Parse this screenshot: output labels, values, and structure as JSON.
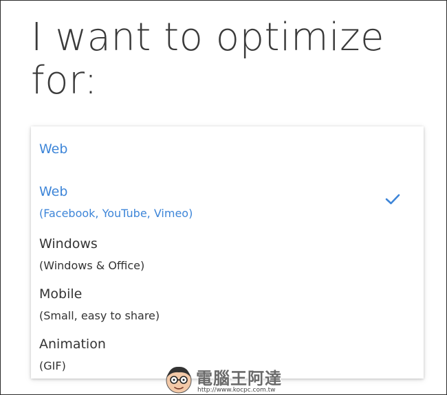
{
  "heading": "I want to optimize for:",
  "dropdown": {
    "selected_value": "Web",
    "options": [
      {
        "title": "Web",
        "subtitle": "(Facebook, YouTube, Vimeo)",
        "selected": true
      },
      {
        "title": "Windows",
        "subtitle": "(Windows & Office)",
        "selected": false
      },
      {
        "title": "Mobile",
        "subtitle": "(Small, easy to share)",
        "selected": false
      },
      {
        "title": "Animation",
        "subtitle": "(GIF)",
        "selected": false
      }
    ]
  },
  "watermark": {
    "brand": "電腦王阿達",
    "url": "http://www.kocpc.com.tw"
  },
  "colors": {
    "accent": "#3d85d8",
    "text": "#333333",
    "heading": "#3a3a3a"
  },
  "icons": {
    "check": "checkmark-icon",
    "mascot": "mascot-face-icon"
  }
}
